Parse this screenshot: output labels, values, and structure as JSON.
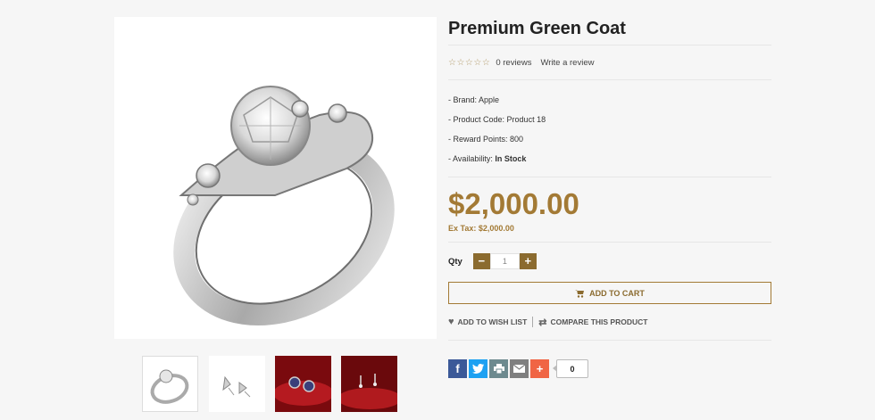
{
  "product": {
    "title": "Premium Green Coat",
    "reviews": "0 reviews",
    "write_review": "Write a review",
    "brand_label": "- Brand:",
    "brand": "Apple",
    "code_label": "- Product Code:",
    "code": "Product 18",
    "reward_label": "- Reward Points:",
    "reward": "800",
    "availability_label": "- Availability:",
    "availability": "In Stock",
    "price": "$2,000.00",
    "ex_tax_label": "Ex Tax:",
    "ex_tax": "$2,000.00"
  },
  "qty": {
    "label": "Qty",
    "minus": "−",
    "value": "1",
    "plus": "+"
  },
  "actions": {
    "add_to_cart": "ADD TO CART",
    "wishlist": "ADD TO WISH LIST",
    "compare": "COMPARE THIS PRODUCT"
  },
  "share": {
    "count": "0",
    "colors": {
      "facebook": "#3b5998",
      "twitter": "#1da1f2",
      "print": "#6d8a8f",
      "email": "#7f7f7f",
      "more": "#f06544"
    }
  },
  "stars": "☆☆☆☆☆",
  "thumbnails": [
    "ring-thumb",
    "earring-thumb",
    "blue-earring-thumb",
    "stud-earring-thumb"
  ],
  "colors": {
    "accent": "#a37a35",
    "button": "#8b6b2f"
  }
}
